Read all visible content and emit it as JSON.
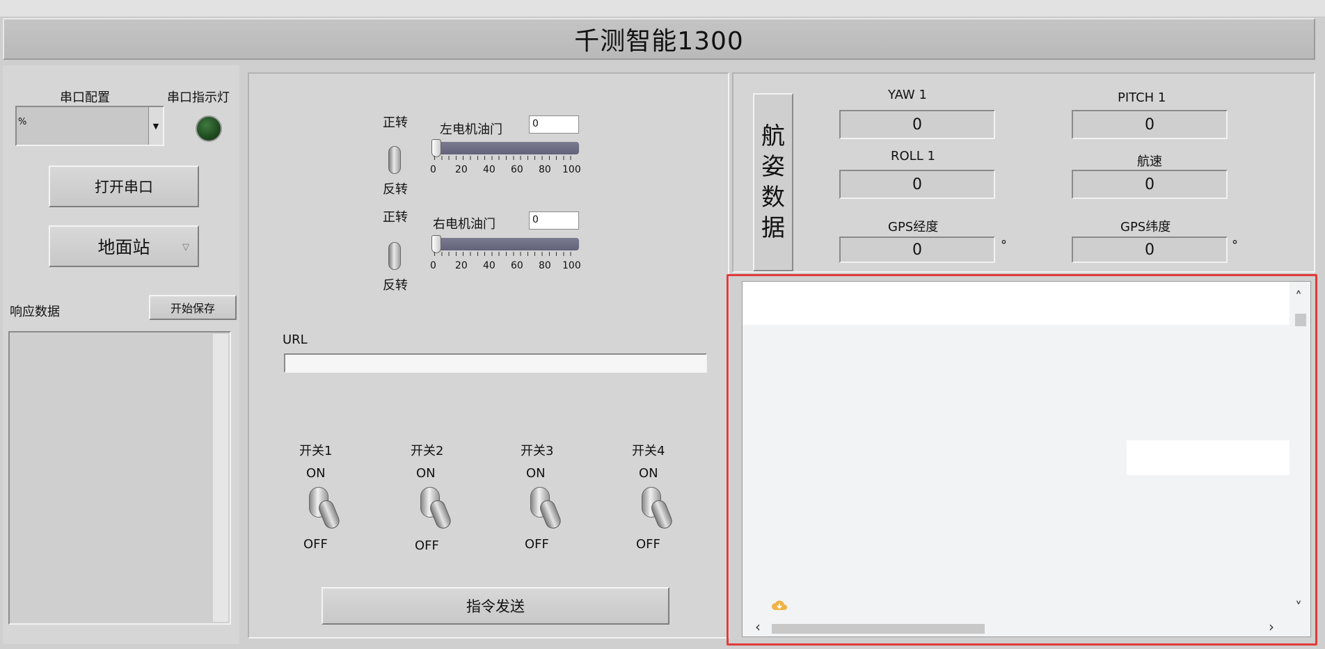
{
  "window": {
    "title": "千测智能1300"
  },
  "serial": {
    "config_label": "串口配置",
    "indicator_label": "串口指示灯",
    "combo_value": "%",
    "open_button": "打开串口",
    "mode_button": "地面站",
    "response_label": "响应数据",
    "save_button": "开始保存"
  },
  "motors": {
    "left": {
      "forward": "正转",
      "reverse": "反转",
      "throttle_label": "左电机油门",
      "value": "0",
      "level": 0
    },
    "right": {
      "forward": "正转",
      "reverse": "反转",
      "throttle_label": "右电机油门",
      "value": "0",
      "level": 0
    },
    "ticks": [
      "0",
      "20",
      "40",
      "60",
      "80",
      "100"
    ]
  },
  "url": {
    "label": "URL",
    "value": ""
  },
  "switches": [
    {
      "label": "开关1",
      "on": "ON",
      "off": "OFF"
    },
    {
      "label": "开关2",
      "on": "ON",
      "off": "OFF"
    },
    {
      "label": "开关3",
      "on": "ON",
      "off": "OFF"
    },
    {
      "label": "开关4",
      "on": "ON",
      "off": "OFF"
    }
  ],
  "send_button": "指令发送",
  "attitude": {
    "heading": [
      "航",
      "姿",
      "数",
      "据"
    ],
    "yaw_label": "YAW 1",
    "yaw_value": "0",
    "pitch_label": "PITCH 1",
    "pitch_value": "0",
    "roll_label": "ROLL 1",
    "roll_value": "0",
    "speed_label": "航速",
    "speed_value": "0",
    "lon_label": "GPS经度",
    "lon_value": "0",
    "lat_label": "GPS纬度",
    "lat_value": "0",
    "degree_symbol": "°"
  },
  "colors": {
    "highlight": "#e23a3a",
    "led": "#1f4a1f"
  }
}
